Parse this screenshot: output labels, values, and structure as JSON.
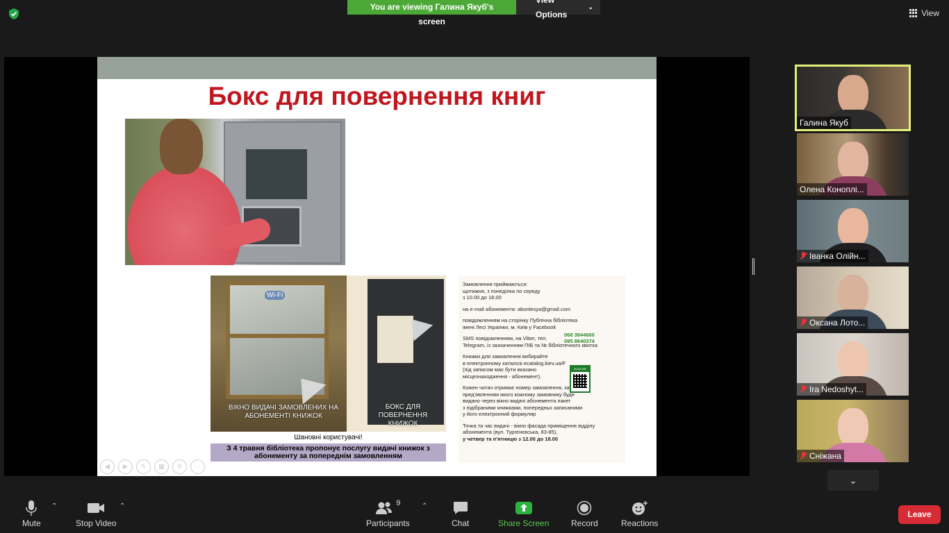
{
  "top": {
    "viewing_text": "You are viewing Галина Якуб's screen",
    "view_options": "View Options",
    "view_button": "View"
  },
  "slide": {
    "title": "Бокс для повернення книг",
    "photo_caption_left": "ВІКНО ВИДАЧІ ЗАМОВЛЕНИХ НА АБОНЕМЕНТІ КНИЖОК",
    "photo_caption_right": "БОКС ДЛЯ ПОВЕРНЕННЯ КНИЖОК",
    "wifi_sign": "Wi-Fi",
    "notice_greeting": "Шановні користувачі!",
    "notice_text": "З 4 травня бібліотека пропонує послугу видачі книжок з абонементу за попереднім замовленням",
    "info": {
      "p1_line1": "Замовлення приймаються:",
      "p1_line2": "щотижня, з понеділка по середу",
      "p1_line3": "з 10.00 до 18.00",
      "p2": "на e-mail абонемента: abonlesya@gmail.com",
      "p3_line1": "повідомленням на сторінку Публічна бібліотека",
      "p3_line2": "імені Лесі Українки, м. Київ   у Facebook",
      "phone1": "068 3844660",
      "phone2": "095 8640374",
      "p4_line1": "SMS повідомленням,  на Viber,        тел.",
      "p4_line2": "Telegram, із зазначенням ПІБ та № бібліотечного квитка",
      "p5_line1": "Книжки для замовлення вибирайте",
      "p5_line2": "в електронному каталозі  ecatalog.kiev.ua/F",
      "p5_line3": "(під записом має бути вказано",
      "p5_line4": "місцезнаходження - абонемент).",
      "qr_label": "SCAN ME",
      "p6_line1": "Кожен читач отримає номер замовлення, за",
      "p6_line2": "пред'явленням якого кожному замовнику буде",
      "p6_line3": "видано через вікно видачі абонемента пакет",
      "p6_line4": "з підібраними книжками, попередньо записаними",
      "p6_line5": "у його електронний формуляр",
      "p7_line1": "Точка та час  видачі - вікно фасада приміщення відділу",
      "p7_line2": "абонемента (вул. Тургенєвська, 83-85),",
      "p7_line3": "у четвер та п'ятницю  з 12.00 до 18.00"
    }
  },
  "participants": [
    {
      "name": "Галина Якуб",
      "muted": false,
      "active": true
    },
    {
      "name": "Олена Коноплі...",
      "muted": false,
      "active": false
    },
    {
      "name": "Іванка Олійн...",
      "muted": true,
      "active": false
    },
    {
      "name": "Оксана Лото...",
      "muted": true,
      "active": false
    },
    {
      "name": "Ira Nedoshyt...",
      "muted": true,
      "active": false
    },
    {
      "name": "Сніжана",
      "muted": true,
      "active": false
    }
  ],
  "toolbar": {
    "mute": "Mute",
    "stop_video": "Stop Video",
    "participants": "Participants",
    "participant_count": "9",
    "chat": "Chat",
    "share_screen": "Share Screen",
    "record": "Record",
    "reactions": "Reactions",
    "leave": "Leave"
  },
  "colors": {
    "accent_green": "#4ca837",
    "leave_red": "#d72c36",
    "active_speaker": "#e3f07a",
    "title_red": "#c0161e"
  }
}
